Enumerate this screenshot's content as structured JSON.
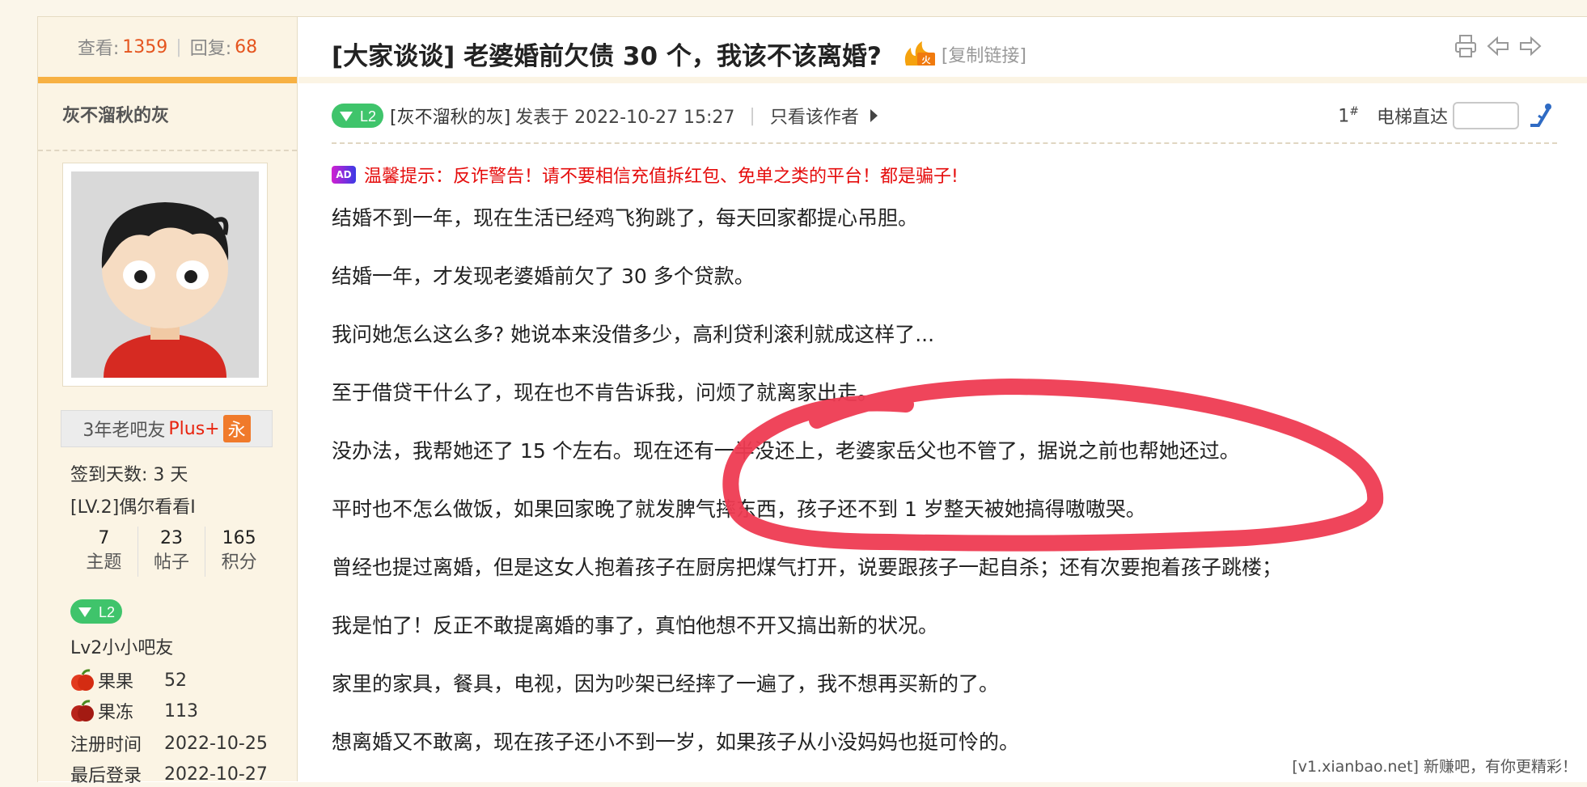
{
  "sidebar": {
    "views_label": "查看:",
    "views_value": "1359",
    "replies_label": "回复:",
    "replies_value": "68",
    "author_name": "灰不溜秋的灰",
    "member_title": "3年老吧友",
    "member_plus": "Plus+",
    "member_yong": "永",
    "checkin": "签到天数: 3 天",
    "level_title": "[LV.2]偶尔看看I",
    "counts": [
      {
        "value": "7",
        "label": "主题"
      },
      {
        "value": "23",
        "label": "帖子"
      },
      {
        "value": "165",
        "label": "积分"
      }
    ],
    "level_badge": "L2",
    "group_name": "Lv2小小吧友",
    "guoguo_label": "果果",
    "guoguo_value": "52",
    "guodong_label": "果冻",
    "guodong_value": "113",
    "reg_label": "注册时间",
    "reg_value": "2022-10-25",
    "last_label": "最后登录",
    "last_value": "2022-10-27"
  },
  "post": {
    "title": "[大家谈谈] 老婆婚前欠债 30 个，我该不该离婚?",
    "copy_link": "[复制链接]",
    "level_badge": "L2",
    "author_link": "[灰不溜秋的灰]",
    "posted_at": "发表于 2022-10-27 15:27",
    "only_author": "只看该作者",
    "floor": "1",
    "floor_mark": "#",
    "elevator": "电梯直达",
    "warning": "温馨提示：反诈警告！请不要相信充值拆红包、免单之类的平台！都是骗子!",
    "paragraphs": [
      "结婚不到一年，现在生活已经鸡飞狗跳了，每天回家都提心吊胆。",
      "结婚一年，才发现老婆婚前欠了 30 多个贷款。",
      "我问她怎么这么多? 她说本来没借多少，高利贷利滚利就成这样了...",
      "至于借贷干什么了，现在也不肯告诉我，问烦了就离家出走。",
      "没办法，我帮她还了 15 个左右。现在还有一半没还上，老婆家岳父也不管了，据说之前也帮她还过。",
      "平时也不怎么做饭，如果回家晚了就发脾气摔东西，孩子还不到 1 岁整天被她搞得嗷嗷哭。",
      "曾经也提过离婚，但是这女人抱着孩子在厨房把煤气打开，说要跟孩子一起自杀；还有次要抱着孩子跳楼；",
      "我是怕了！反正不敢提离婚的事了，真怕他想不开又搞出新的状况。",
      "家里的家具，餐具，电视，因为吵架已经摔了一遍了，我不想再买新的了。",
      "想离婚又不敢离，现在孩子还小不到一岁，如果孩子从小没妈妈也挺可怜的。"
    ]
  },
  "watermark": "[v1.xianbao.net] 新赚吧，有你更精彩！",
  "icons": [
    "print-icon",
    "prev-thread-icon",
    "next-thread-icon",
    "elevator-icon",
    "hot-icon",
    "ad-icon",
    "apple-icon"
  ],
  "colors": {
    "accent": "#e5551f",
    "warning": "#e50c0c",
    "scribble": "#ee3b52",
    "badge": "#3fc46b"
  }
}
